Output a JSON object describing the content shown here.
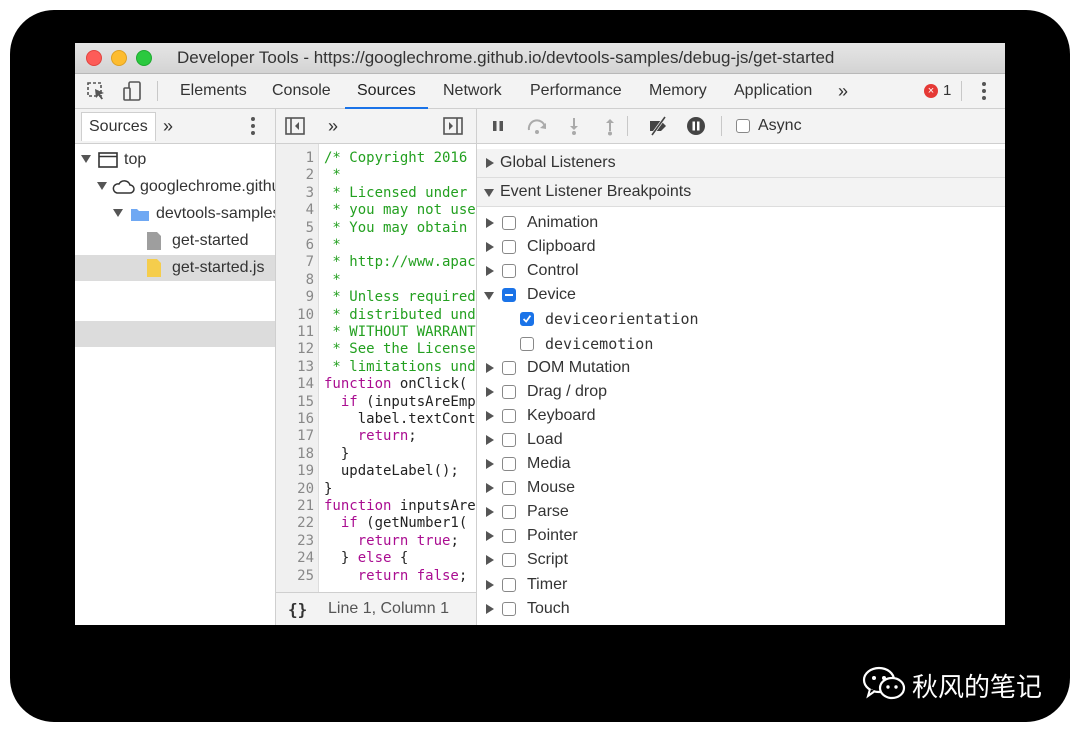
{
  "window": {
    "title": "Developer Tools - https://googlechrome.github.io/devtools-samples/debug-js/get-started"
  },
  "main_tabs": [
    {
      "label": "Elements",
      "active": false
    },
    {
      "label": "Console",
      "active": false
    },
    {
      "label": "Sources",
      "active": true
    },
    {
      "label": "Network",
      "active": false
    },
    {
      "label": "Performance",
      "active": false
    },
    {
      "label": "Memory",
      "active": false
    },
    {
      "label": "Application",
      "active": false
    }
  ],
  "overflow_label": "»",
  "error_count": "1",
  "error_badge": "×",
  "navigator": {
    "tab_label": "Sources",
    "overflow_label": "»",
    "tree": [
      {
        "label": "top",
        "depth": 0,
        "type": "frame"
      },
      {
        "label": "googlechrome.github.io",
        "depth": 1,
        "type": "domain"
      },
      {
        "label": "devtools-samples/debug-js",
        "depth": 2,
        "type": "folder"
      },
      {
        "label": "get-started",
        "depth": 3,
        "type": "file"
      },
      {
        "label": "get-started.js",
        "depth": 3,
        "type": "js-file",
        "selected": true
      }
    ]
  },
  "editor": {
    "overflow_label": "»",
    "lines": [
      {
        "n": "1",
        "text": "/* Copyright 2016",
        "kind": "com"
      },
      {
        "n": "2",
        "text": " *",
        "kind": "com"
      },
      {
        "n": "3",
        "text": " * Licensed under",
        "kind": "com"
      },
      {
        "n": "4",
        "text": " * you may not use",
        "kind": "com"
      },
      {
        "n": "5",
        "text": " * You may obtain",
        "kind": "com"
      },
      {
        "n": "6",
        "text": " *",
        "kind": "com"
      },
      {
        "n": "7",
        "text": " * http://www.apac",
        "kind": "com"
      },
      {
        "n": "8",
        "text": " *",
        "kind": "com"
      },
      {
        "n": "9",
        "text": " * Unless required",
        "kind": "com"
      },
      {
        "n": "10",
        "text": " * distributed und",
        "kind": "com"
      },
      {
        "n": "11",
        "text": " * WITHOUT WARRANT",
        "kind": "com"
      },
      {
        "n": "12",
        "text": " * See the License",
        "kind": "com"
      },
      {
        "n": "13",
        "text": " * limitations und",
        "kind": "com"
      },
      {
        "n": "14",
        "text": "function onClick(",
        "kind": "fn"
      },
      {
        "n": "15",
        "text": "  if (inputsAreEmp",
        "kind": "if"
      },
      {
        "n": "16",
        "text": "    label.textCont",
        "kind": "txt"
      },
      {
        "n": "17",
        "text": "    return;",
        "kind": "ret"
      },
      {
        "n": "18",
        "text": "  }",
        "kind": "txt"
      },
      {
        "n": "19",
        "text": "  updateLabel();",
        "kind": "txt"
      },
      {
        "n": "20",
        "text": "}",
        "kind": "txt"
      },
      {
        "n": "21",
        "text": "function inputsAre",
        "kind": "fn"
      },
      {
        "n": "22",
        "text": "  if (getNumber1(",
        "kind": "if"
      },
      {
        "n": "23",
        "text": "    return true;",
        "kind": "rettrue"
      },
      {
        "n": "24",
        "text": "  } else {",
        "kind": "else"
      },
      {
        "n": "25",
        "text": "    return false;",
        "kind": "retfalse"
      }
    ],
    "pretty_print_label": "{}",
    "cursor_position": "Line 1, Column 1"
  },
  "debugger": {
    "async_label": "Async",
    "async_checked": false,
    "sections": [
      {
        "label": "Global Listeners",
        "expanded": false
      },
      {
        "label": "Event Listener Breakpoints",
        "expanded": true
      }
    ],
    "breakpoints": [
      {
        "label": "Animation",
        "state": "unchecked",
        "expanded": false,
        "depth": 0
      },
      {
        "label": "Clipboard",
        "state": "unchecked",
        "expanded": false,
        "depth": 0
      },
      {
        "label": "Control",
        "state": "unchecked",
        "expanded": false,
        "depth": 0
      },
      {
        "label": "Device",
        "state": "mixed",
        "expanded": true,
        "depth": 0
      },
      {
        "label": "deviceorientation",
        "state": "checked",
        "depth": 1
      },
      {
        "label": "devicemotion",
        "state": "unchecked",
        "depth": 1
      },
      {
        "label": "DOM Mutation",
        "state": "unchecked",
        "expanded": false,
        "depth": 0
      },
      {
        "label": "Drag / drop",
        "state": "unchecked",
        "expanded": false,
        "depth": 0
      },
      {
        "label": "Keyboard",
        "state": "unchecked",
        "expanded": false,
        "depth": 0
      },
      {
        "label": "Load",
        "state": "unchecked",
        "expanded": false,
        "depth": 0
      },
      {
        "label": "Media",
        "state": "unchecked",
        "expanded": false,
        "depth": 0
      },
      {
        "label": "Mouse",
        "state": "unchecked",
        "expanded": false,
        "depth": 0
      },
      {
        "label": "Parse",
        "state": "unchecked",
        "expanded": false,
        "depth": 0
      },
      {
        "label": "Pointer",
        "state": "unchecked",
        "expanded": false,
        "depth": 0
      },
      {
        "label": "Script",
        "state": "unchecked",
        "expanded": false,
        "depth": 0
      },
      {
        "label": "Timer",
        "state": "unchecked",
        "expanded": false,
        "depth": 0
      },
      {
        "label": "Touch",
        "state": "unchecked",
        "expanded": false,
        "depth": 0
      }
    ]
  },
  "watermark": {
    "text": "秋风的笔记",
    "icon": "wechat-icon"
  },
  "colors": {
    "accent": "#1a73e8",
    "comment": "#23a020",
    "keyword": "#aa0d91",
    "error": "#e53935"
  }
}
